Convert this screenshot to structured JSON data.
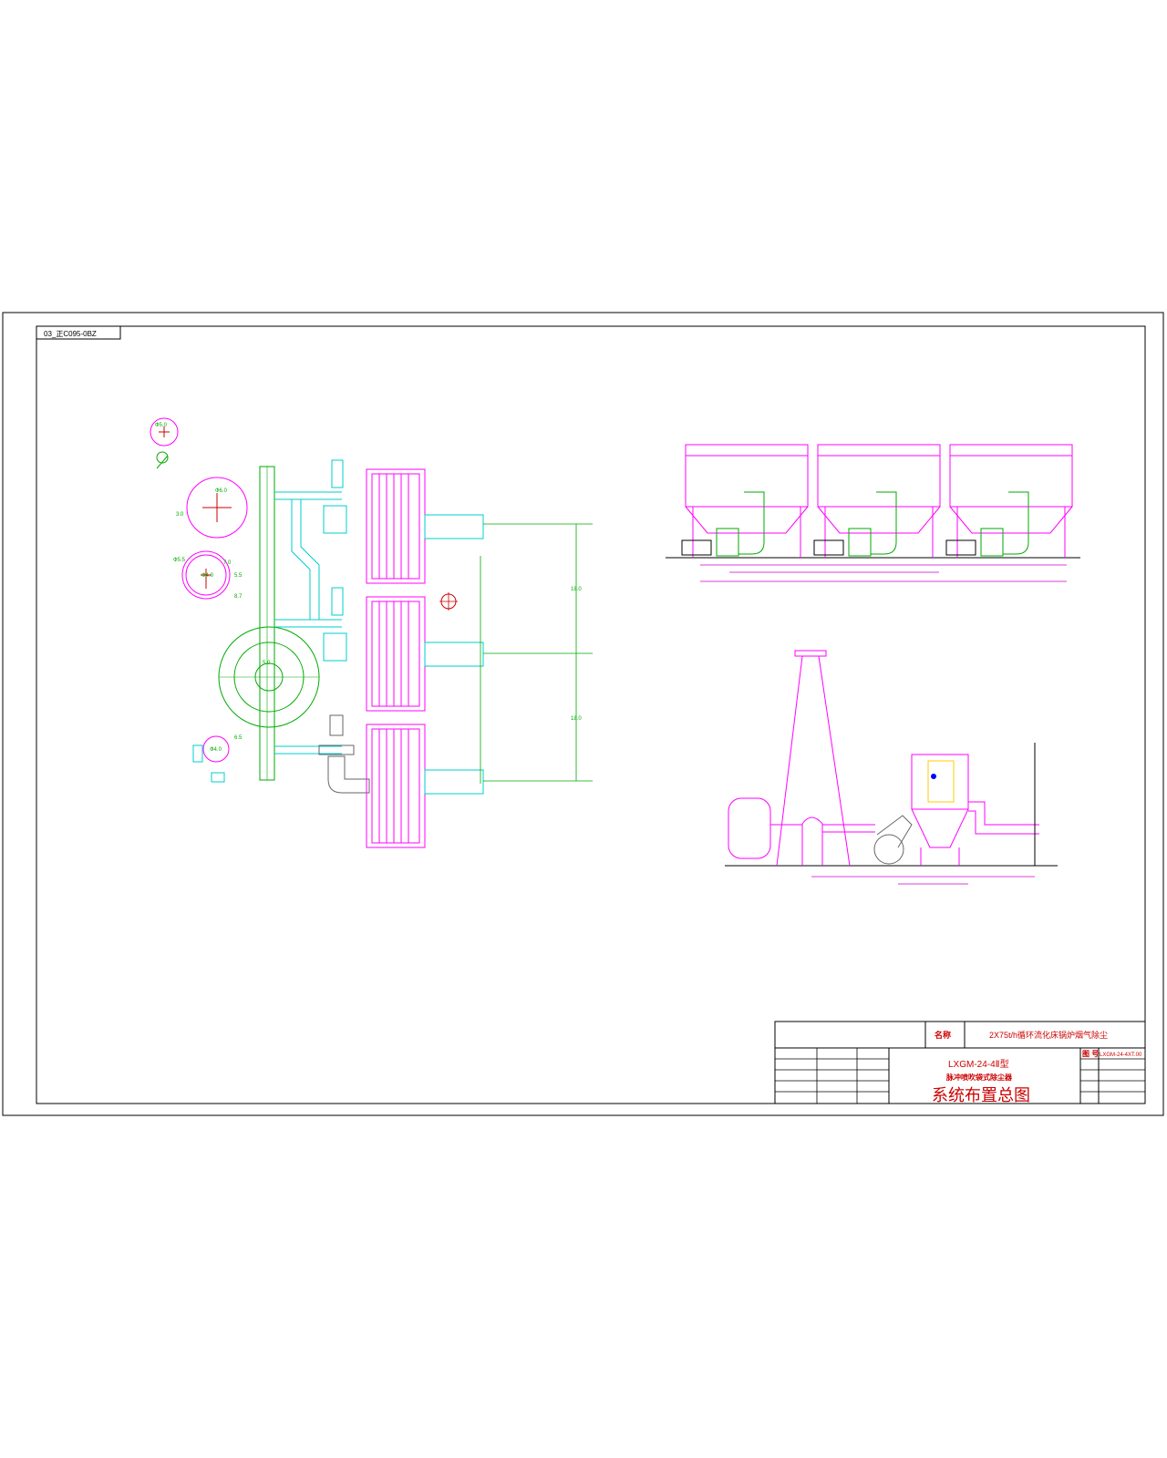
{
  "sheet": {
    "drawing_code": "03_正C095-0BZ",
    "colors": {
      "frame": "#000000",
      "magenta": "#ff00ff",
      "cyan": "#00cccc",
      "green": "#00aa00",
      "red": "#cc0000",
      "yellow": "#ffff00",
      "blue": "#0000ff"
    }
  },
  "plan_view": {
    "dims": {
      "d1": "Ф5.0",
      "d2": "Ф6.0",
      "d3": "3.0",
      "d4": "Ф5.5",
      "d5": "7.0",
      "d6": "Ф4.0",
      "d7": "5.5",
      "d8": "8.7",
      "d9": "5.0",
      "d10": "Ф4.0",
      "d11": "6.5",
      "d12": "18.0",
      "d13": "18.0"
    }
  },
  "title_block": {
    "name_label": "名称",
    "project_title": "2X75t/h循环流化床锅炉烟气除尘",
    "model": "LXGM-24-4Ⅱ型",
    "product": "脉冲喷吹袋式除尘器",
    "drawing_title": "系统布置总图",
    "number_label": "图 号",
    "drawing_number": "LXGM-24-4XT.00"
  }
}
